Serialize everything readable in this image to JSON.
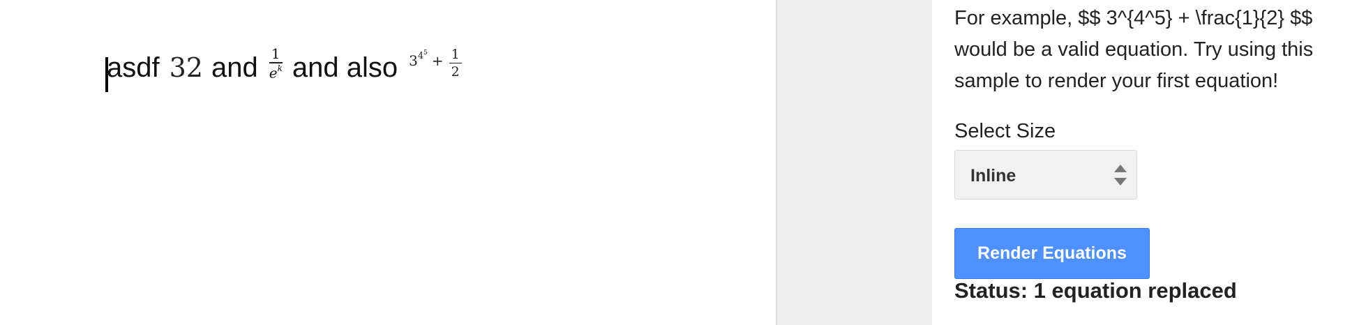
{
  "document": {
    "line": {
      "text_1": "asdf",
      "math_1": "32",
      "text_2": "and",
      "frac_1": {
        "num": "1",
        "den_base": "e",
        "den_exp": "k"
      },
      "text_3": "and also",
      "expr_2": {
        "base": "3",
        "exp_base": "4",
        "exp_exp": "5",
        "plus": "+",
        "frac": {
          "num": "1",
          "den": "2"
        }
      }
    }
  },
  "sidebar": {
    "help_text": "For example, $$ 3^{4^5} + \\frac{1}{2} $$ would be a valid equation. Try using this sample to render your first equation!",
    "select_size_label": "Select Size",
    "select_size_value": "Inline",
    "render_button_label": "Render Equations",
    "status_text": "Status: 1 equation replaced"
  },
  "colors": {
    "button_blue": "#4d90fe",
    "gutter_gray": "#eeeeee"
  }
}
